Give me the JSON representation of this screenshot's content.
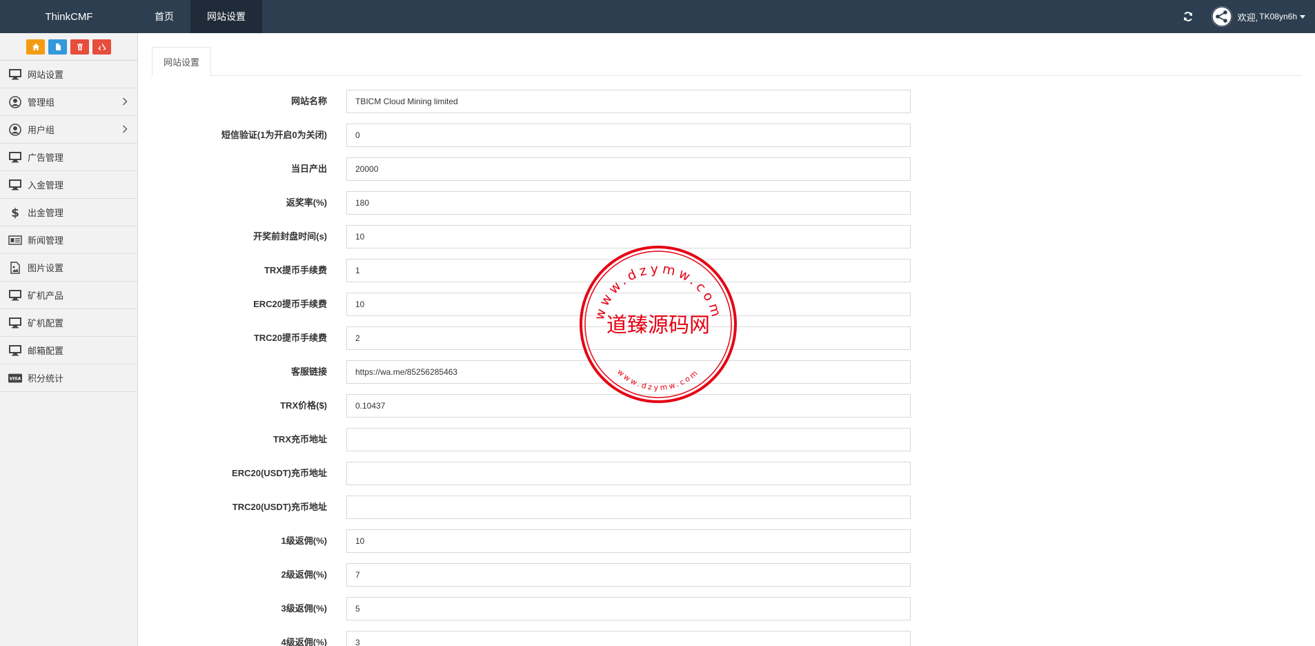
{
  "topnav": {
    "brand": "ThinkCMF",
    "items": [
      {
        "label": "首页",
        "active": false
      },
      {
        "label": "网站设置",
        "active": true
      }
    ],
    "welcome": "欢迎,",
    "username": "TK08yn6h"
  },
  "sidebar": {
    "shortcuts": [
      {
        "icon": "home-icon",
        "color": "#f39c12"
      },
      {
        "icon": "file-icon",
        "color": "#3498db"
      },
      {
        "icon": "trash-icon",
        "color": "#e74c3c"
      },
      {
        "icon": "recycle-icon",
        "color": "#e74c3c"
      }
    ],
    "items": [
      {
        "label": "网站设置",
        "icon": "monitor-icon",
        "has_submenu": false
      },
      {
        "label": "管理组",
        "icon": "user-circle-icon",
        "has_submenu": true
      },
      {
        "label": "用户组",
        "icon": "user-circle-icon",
        "has_submenu": true
      },
      {
        "label": "广告管理",
        "icon": "monitor-icon",
        "has_submenu": false
      },
      {
        "label": "入金管理",
        "icon": "monitor-icon",
        "has_submenu": false
      },
      {
        "label": "出金管理",
        "icon": "dollar-icon",
        "has_submenu": false
      },
      {
        "label": "新闻管理",
        "icon": "newspaper-icon",
        "has_submenu": false
      },
      {
        "label": "图片设置",
        "icon": "image-icon",
        "has_submenu": false
      },
      {
        "label": "矿机产品",
        "icon": "monitor-icon",
        "has_submenu": false
      },
      {
        "label": "矿机配置",
        "icon": "monitor-icon",
        "has_submenu": false
      },
      {
        "label": "邮箱配置",
        "icon": "monitor-icon",
        "has_submenu": false
      },
      {
        "label": "积分统计",
        "icon": "visa-icon",
        "has_submenu": false
      }
    ]
  },
  "main": {
    "tab": "网站设置",
    "fields": [
      {
        "label": "网站名称",
        "value": "TBICM Cloud Mining limited"
      },
      {
        "label": "短信验证(1为开启0为关闭)",
        "value": "0"
      },
      {
        "label": "当日产出",
        "value": "20000"
      },
      {
        "label": "返奖率(%)",
        "value": "180"
      },
      {
        "label": "开奖前封盘时间(s)",
        "value": "10"
      },
      {
        "label": "TRX提币手续费",
        "value": "1"
      },
      {
        "label": "ERC20提币手续费",
        "value": "10"
      },
      {
        "label": "TRC20提币手续费",
        "value": "2"
      },
      {
        "label": "客服链接",
        "value": "https://wa.me/85256285463"
      },
      {
        "label": "TRX价格($)",
        "value": "0.10437"
      },
      {
        "label": "TRX充币地址",
        "value": ""
      },
      {
        "label": "ERC20(USDT)充币地址",
        "value": ""
      },
      {
        "label": "TRC20(USDT)充币地址",
        "value": ""
      },
      {
        "label": "1级返佣(%)",
        "value": "10"
      },
      {
        "label": "2级返佣(%)",
        "value": "7"
      },
      {
        "label": "3级返佣(%)",
        "value": "5"
      },
      {
        "label": "4级返佣(%)",
        "value": "3"
      }
    ]
  },
  "watermark": {
    "top_text": "www.dzymw.com",
    "center_text": "道臻源码网",
    "bottom_text": "www.dzymw.com",
    "color": "#e60012"
  }
}
